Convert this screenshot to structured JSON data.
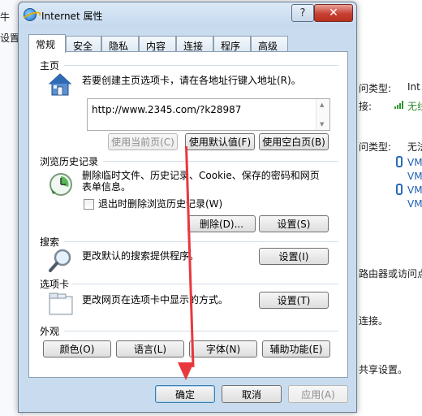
{
  "background": {
    "left_text_1": "牛",
    "left_text_2": "设置",
    "right_lines": [
      {
        "label": "问类型:",
        "value": "Int"
      },
      {
        "label": "接:",
        "value": "无线"
      },
      {
        "label": "问类型:",
        "value": "无法"
      },
      {
        "label": "",
        "value": "VM"
      },
      {
        "label": "",
        "value": "VM"
      },
      {
        "label": "",
        "value": "VM"
      },
      {
        "label": "",
        "value": "VM"
      }
    ],
    "text_router": "路由器或访问点",
    "text_connect": "连接。",
    "text_share": "共享设置。"
  },
  "window": {
    "title": "Internet 属性",
    "help_label": "?",
    "close_label": "✕"
  },
  "tabs": [
    {
      "label": "常规",
      "active": true
    },
    {
      "label": "安全"
    },
    {
      "label": "隐私"
    },
    {
      "label": "内容"
    },
    {
      "label": "连接"
    },
    {
      "label": "程序"
    },
    {
      "label": "高级"
    }
  ],
  "homepage": {
    "group": "主页",
    "description": "若要创建主页选项卡，请在各地址行键入地址(R)。",
    "url": "http://www.2345.com/?k28987",
    "use_current": "使用当前页(C)",
    "use_default": "使用默认值(F)",
    "use_blank": "使用空白页(B)"
  },
  "history": {
    "group": "浏览历史记录",
    "description_line1": "删除临时文件、历史记录、Cookie、保存的密码和网页",
    "description_line2": "表单信息。",
    "checkbox_label": "退出时删除浏览历史记录(W)",
    "delete_button": "删除(D)...",
    "settings_button": "设置(S)"
  },
  "search": {
    "group": "搜索",
    "description": "更改默认的搜索提供程序。",
    "settings_button": "设置(I)"
  },
  "tabs_section": {
    "group": "选项卡",
    "description": "更改网页在选项卡中显示的方式。",
    "settings_button": "设置(T)"
  },
  "appearance": {
    "group": "外观",
    "colors": "颜色(O)",
    "languages": "语言(L)",
    "fonts": "字体(N)",
    "accessibility": "辅助功能(E)"
  },
  "footer": {
    "ok": "确定",
    "cancel": "取消",
    "apply": "应用(A)"
  },
  "colors": {
    "annotation_arrow": "#e8383d",
    "close_button": "#c74032"
  }
}
